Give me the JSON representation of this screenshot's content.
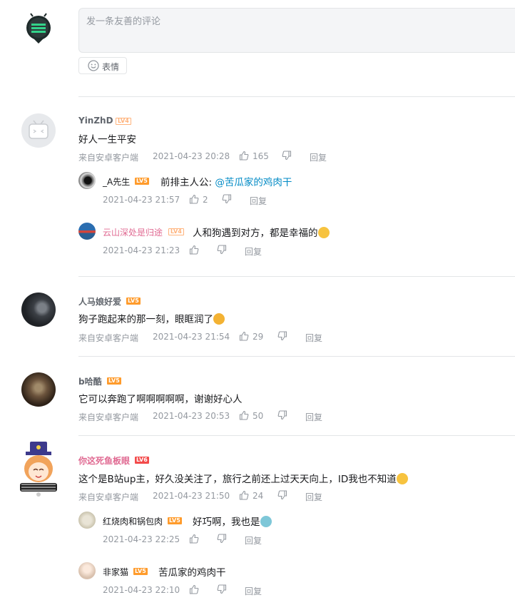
{
  "composer": {
    "placeholder": "发一条友善的评论",
    "emoji_label": "表情"
  },
  "comments": [
    {
      "user": "YinZhD",
      "level": "LV4",
      "content": "好人一生平安",
      "source": "来自安卓客户端",
      "time": "2021-04-23 20:28",
      "likes": "165",
      "reply": "回复",
      "replies": [
        {
          "user": "_A先生",
          "level": "LV5",
          "prefix": "前排主人公: ",
          "mention": "@苦瓜家的鸡肉干",
          "content": "",
          "time": "2021-04-23 21:57",
          "likes": "2",
          "reply": "回复"
        },
        {
          "user": "云山深处是归途",
          "level": "LV4",
          "content": "人和狗遇到对方，都是幸福的",
          "time": "2021-04-23 21:23",
          "likes": "",
          "reply": "回复"
        }
      ]
    },
    {
      "user": "人马娘好爱",
      "level": "LV5",
      "content": "狗子跑起来的那一刻，眼眶润了",
      "source": "来自安卓客户端",
      "time": "2021-04-23 21:54",
      "likes": "29",
      "reply": "回复"
    },
    {
      "user": "b哈酷",
      "level": "LV5",
      "content": "它可以奔跑了啊啊啊啊啊，谢谢好心人",
      "source": "来自安卓客户端",
      "time": "2021-04-23 20:53",
      "likes": "50",
      "reply": "回复"
    },
    {
      "user": "你这死鱼板眼",
      "level": "LV6",
      "content": "这个是B站up主，好久没关注了，旅行之前还上过天天向上，ID我也不知道",
      "source": "来自安卓客户端",
      "time": "2021-04-23 21:50",
      "likes": "24",
      "reply": "回复",
      "replies": [
        {
          "user": "红烧肉和锅包肉",
          "level": "LV5",
          "content": "好巧啊，我也是",
          "time": "2021-04-23 22:25",
          "likes": "",
          "reply": "回复"
        },
        {
          "user": "非家猫",
          "level": "LV5",
          "content": "苦瓜家的鸡肉干",
          "time": "2021-04-23 22:10",
          "likes": "",
          "reply": "回复"
        }
      ]
    }
  ],
  "colors": {
    "link": "#008ac5",
    "vip_name": "#e06a92",
    "meta": "#9499a0"
  },
  "icons": [
    "thumb-up-icon",
    "thumb-down-icon",
    "smile-icon"
  ]
}
